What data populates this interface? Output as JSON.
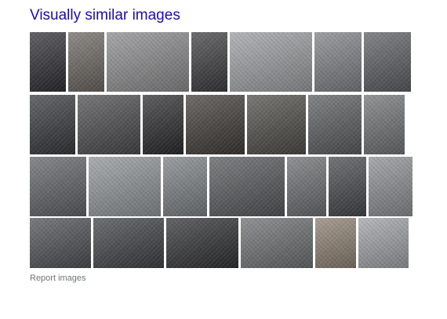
{
  "section": {
    "title": "Visually similar images",
    "report_label": "Report images"
  },
  "rows": [
    {
      "tiles": [
        {
          "subject": "mesh office chair",
          "shade": "#2e2e33"
        },
        {
          "subject": "wire mesh roll",
          "shade": "#6b6560"
        },
        {
          "subject": "stacked expanded metal rolls",
          "shade": "#8a8a8c"
        },
        {
          "subject": "black wire mesh rolls",
          "shade": "#3c3c40"
        },
        {
          "subject": "silver mesh rolls",
          "shade": "#9a9da0"
        },
        {
          "subject": "mesh roll close-up",
          "shade": "#7d8085"
        },
        {
          "subject": "mesh rolls row",
          "shade": "#5b5d61"
        }
      ]
    },
    {
      "tiles": [
        {
          "subject": "black mesh cylinders",
          "shade": "#35373b"
        },
        {
          "subject": "mesh basket",
          "shade": "#4a4a4d"
        },
        {
          "subject": "curved black mesh sheet",
          "shade": "#2a2a2c"
        },
        {
          "subject": "mesh chair back",
          "shade": "#3e3a36"
        },
        {
          "subject": "dark mesh panel",
          "shade": "#4d4b47"
        },
        {
          "subject": "mesh tube",
          "shade": "#595b5e"
        },
        {
          "subject": "mesh sleeves",
          "shade": "#6f7174"
        }
      ]
    },
    {
      "tiles": [
        {
          "subject": "draped mesh sheet",
          "shade": "#5e6166"
        },
        {
          "subject": "stainless mesh rolls",
          "shade": "#8f9397"
        },
        {
          "subject": "mesh roll on floor",
          "shade": "#7b7f83"
        },
        {
          "subject": "large mesh sheet",
          "shade": "#54575a"
        },
        {
          "subject": "grey mesh roll",
          "shade": "#6a6d70"
        },
        {
          "subject": "mesh in crate",
          "shade": "#44474b"
        },
        {
          "subject": "wire mesh stack",
          "shade": "#8b8e92"
        }
      ]
    },
    {
      "tiles": [
        {
          "subject": "mesh tray",
          "shade": "#4c4f53"
        },
        {
          "subject": "mesh panel bent",
          "shade": "#3d4044"
        },
        {
          "subject": "mesh chair seat",
          "shade": "#2f3033"
        },
        {
          "subject": "round mesh disc",
          "shade": "#6c6e71"
        },
        {
          "subject": "mesh in warehouse",
          "shade": "#8c7f70"
        },
        {
          "subject": "mesh roll end",
          "shade": "#9ea1a5"
        }
      ]
    }
  ]
}
